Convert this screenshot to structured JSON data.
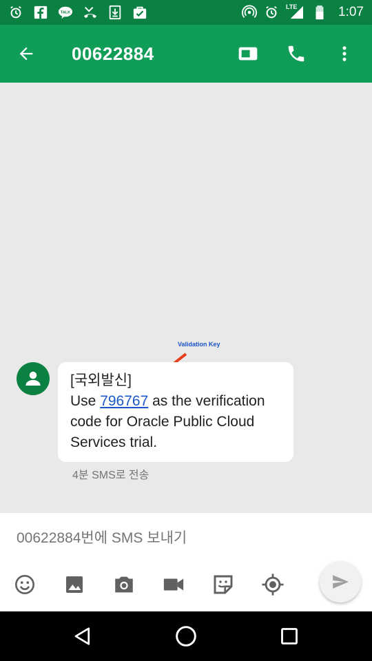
{
  "status_bar": {
    "time": "1:07",
    "network": "LTE",
    "icons": [
      "alarm-icon",
      "facebook-icon",
      "kakaotalk-icon",
      "missed-call-icon",
      "download-icon",
      "task-done-icon",
      "hotspot-icon",
      "alarm-icon",
      "signal-icon",
      "battery-icon"
    ]
  },
  "app_bar": {
    "title": "00622884",
    "icons": [
      "back-arrow-icon",
      "video-call-icon",
      "phone-icon",
      "more-vert-icon"
    ],
    "color": "#0f9d58"
  },
  "annotation": {
    "label": "Validation Key",
    "arrow_color": "#e8401c"
  },
  "message": {
    "line1": "[국외발신]",
    "prefix": "Use ",
    "code": "796767",
    "suffix": " as the verification code for Oracle Public Cloud Services trial.",
    "meta": "4분 SMS로 전송"
  },
  "composer": {
    "placeholder": "00622884번에 SMS 보내기",
    "tools": [
      "emoji-icon",
      "image-icon",
      "camera-icon",
      "video-icon",
      "sticker-icon",
      "location-icon"
    ],
    "send_icon": "send-icon"
  },
  "nav_bar": {
    "icons": [
      "back-triangle-icon",
      "home-circle-icon",
      "recents-square-icon"
    ]
  }
}
